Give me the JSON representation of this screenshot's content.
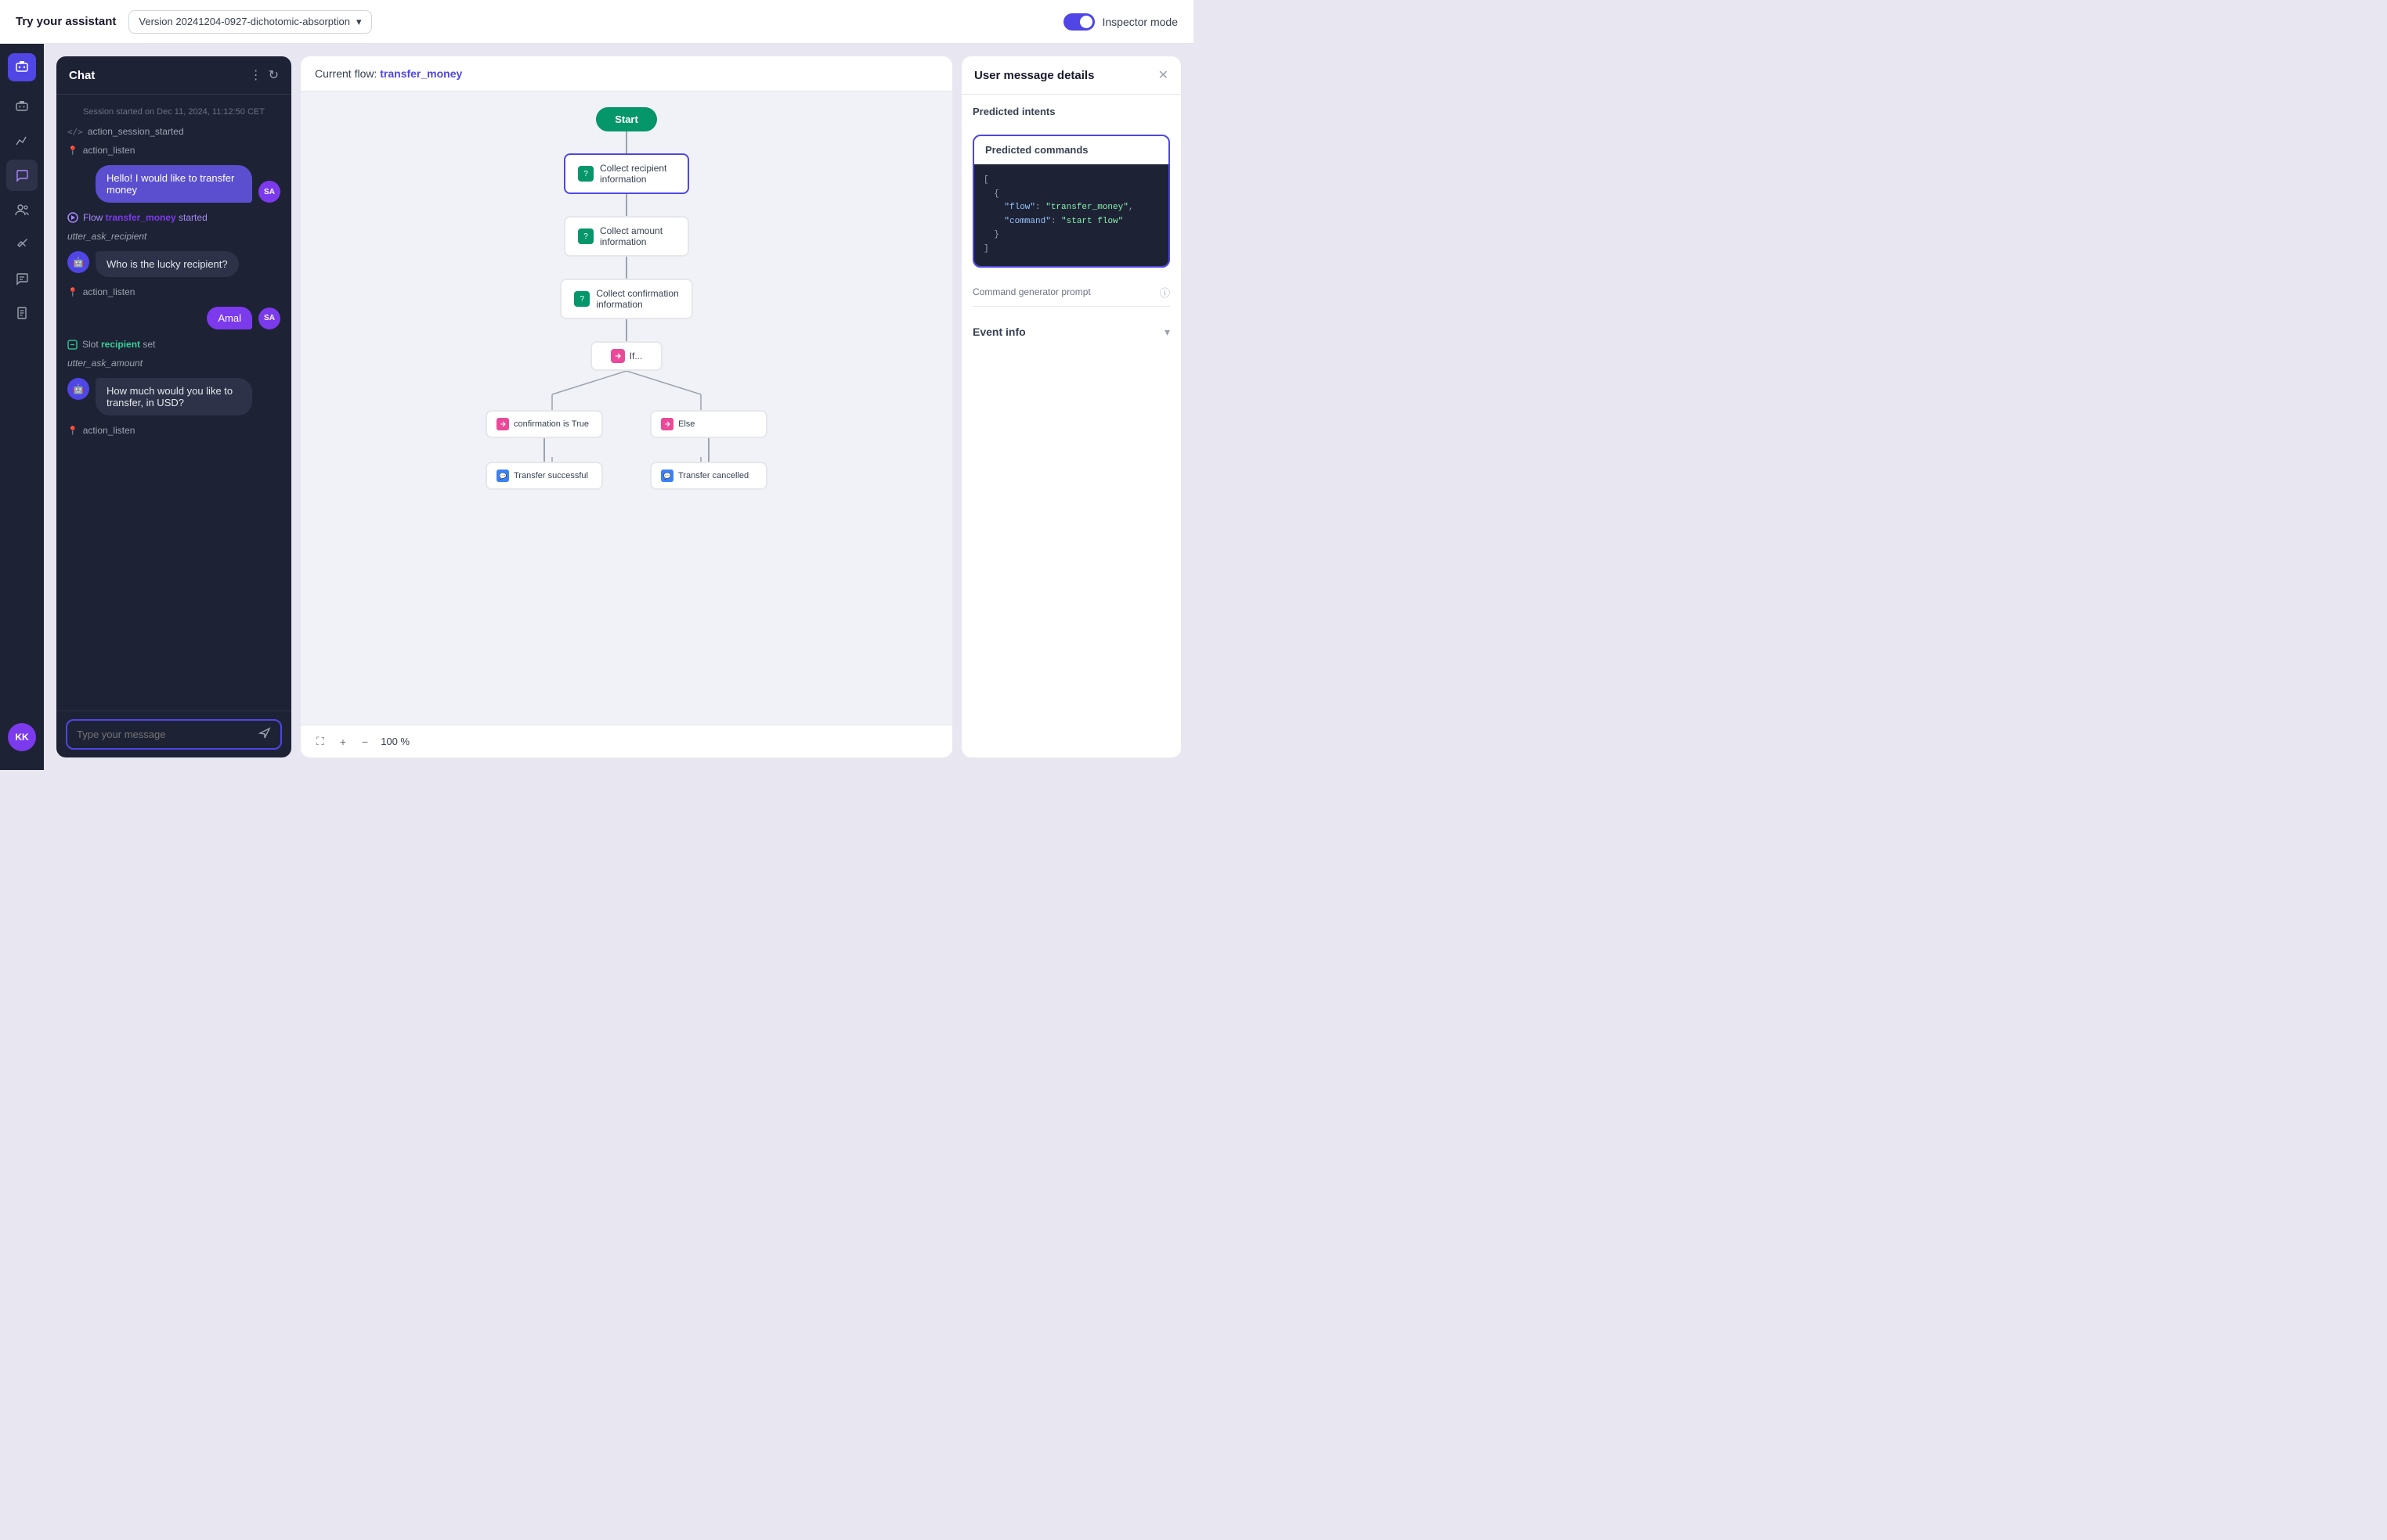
{
  "topbar": {
    "title": "Try your assistant",
    "version": "Version 20241204-0927-dichotomic-absorption",
    "inspector_label": "Inspector mode"
  },
  "sidebar": {
    "logo_initials": "🤖",
    "avatar_initials": "KK",
    "items": [
      {
        "id": "bot",
        "icon": "🤖"
      },
      {
        "id": "analytics",
        "icon": "📈"
      },
      {
        "id": "chat",
        "icon": "💬"
      },
      {
        "id": "users",
        "icon": "👥"
      },
      {
        "id": "tools",
        "icon": "🔧"
      },
      {
        "id": "chat2",
        "icon": "💬"
      },
      {
        "id": "docs",
        "icon": "📄"
      }
    ]
  },
  "chat": {
    "title": "Chat",
    "session_start": "Session started on Dec 11, 2024, 11:12:50 CET",
    "events": [
      {
        "type": "system",
        "text": "action_session_started"
      },
      {
        "type": "system",
        "text": "action_listen"
      },
      {
        "type": "user_message",
        "text": "Hello! I would like to transfer money",
        "avatar": "SA"
      },
      {
        "type": "flow_event",
        "prefix": "Flow",
        "name": "transfer_money",
        "suffix": "started"
      },
      {
        "type": "utter",
        "text": "utter_ask_recipient"
      },
      {
        "type": "bot_message",
        "text": "Who is the lucky recipient?"
      },
      {
        "type": "system",
        "text": "action_listen"
      },
      {
        "type": "user_message",
        "text": "Amal",
        "avatar": "SA"
      },
      {
        "type": "slot_event",
        "prefix": "Slot",
        "name": "recipient",
        "suffix": "set"
      },
      {
        "type": "utter",
        "text": "utter_ask_amount"
      },
      {
        "type": "bot_message",
        "text": "How much would you like to transfer, in USD?"
      },
      {
        "type": "system",
        "text": "action_listen"
      }
    ],
    "input_placeholder": "Type your message"
  },
  "flow": {
    "header_prefix": "Current flow:",
    "flow_name": "transfer_money",
    "nodes": [
      {
        "id": "start",
        "type": "start",
        "label": "Start"
      },
      {
        "id": "collect_recipient",
        "type": "collect",
        "label": "Collect recipient\ninformation",
        "active": true
      },
      {
        "id": "collect_amount",
        "type": "collect",
        "label": "Collect amount\ninformation"
      },
      {
        "id": "collect_confirmation",
        "type": "collect",
        "label": "Collect confirmation\ninformation"
      },
      {
        "id": "if",
        "type": "if",
        "label": "If..."
      },
      {
        "id": "confirmation_true",
        "type": "condition",
        "label": "confirmation is True"
      },
      {
        "id": "else",
        "type": "condition",
        "label": "Else"
      },
      {
        "id": "transfer_successful",
        "type": "action",
        "label": "Transfer successful"
      },
      {
        "id": "transfer_cancelled",
        "type": "action",
        "label": "Transfer cancelled"
      }
    ],
    "zoom": "100 %",
    "zoom_percent": 100
  },
  "inspector": {
    "title": "User message details",
    "predicted_intents_label": "Predicted intents",
    "predicted_commands_label": "Predicted commands",
    "code": [
      "[\n  {\n    \"flow\": \"transfer_money\",\n    \"command\": \"start flow\"\n  }\n]"
    ],
    "command_generator_label": "Command generator prompt",
    "event_info_label": "Event info"
  }
}
